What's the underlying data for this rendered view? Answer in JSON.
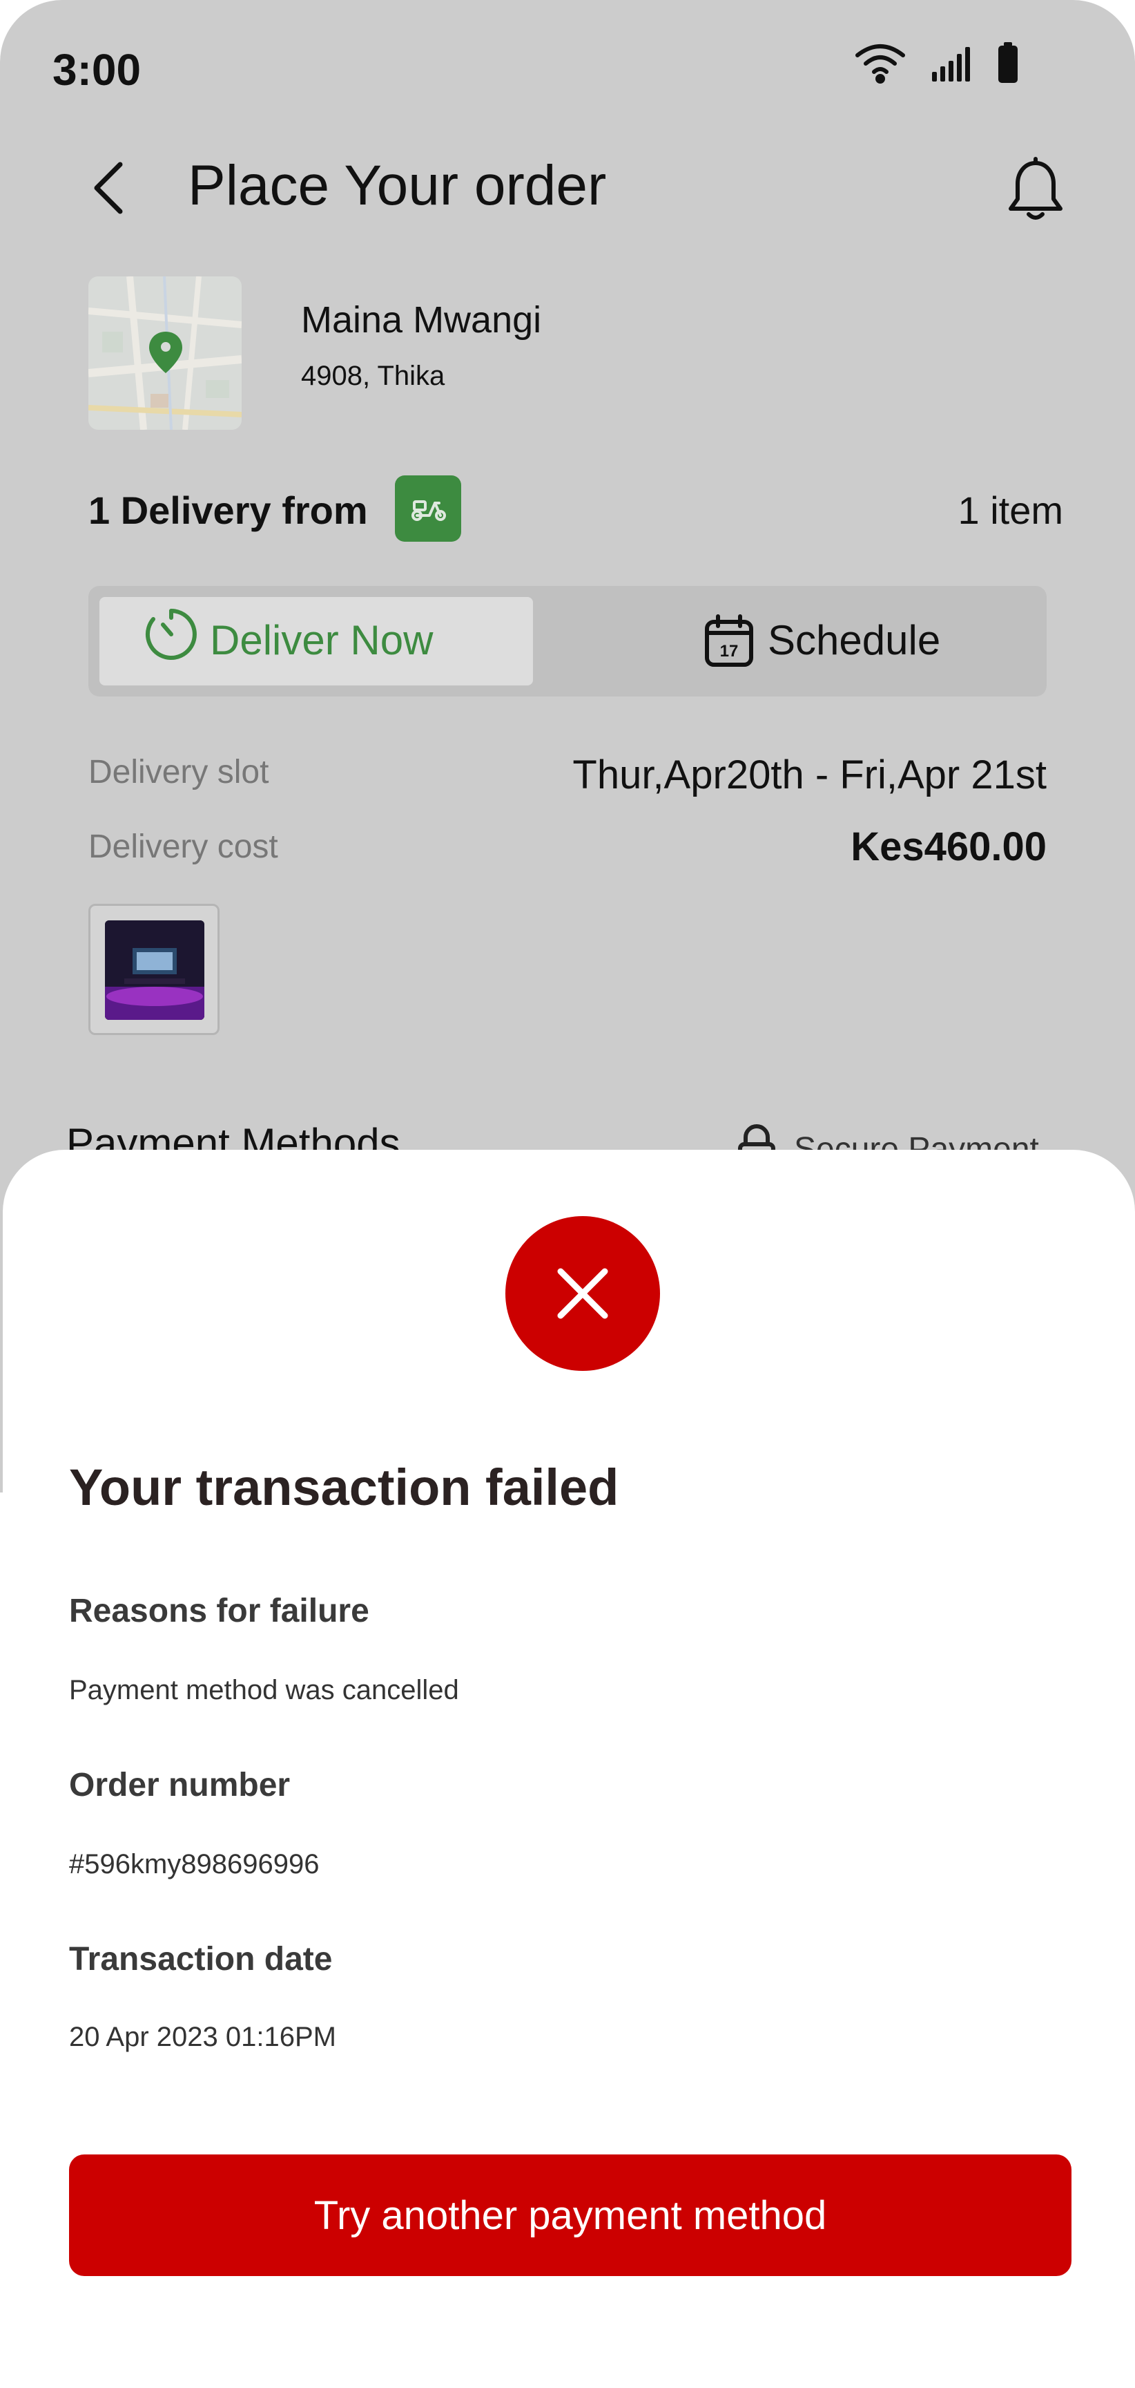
{
  "status_bar": {
    "time": "3:00",
    "icons": [
      "wifi-icon",
      "signal-icon",
      "battery-icon"
    ]
  },
  "header": {
    "title": "Place Your order",
    "back_icon": "chevron-left-icon",
    "notification_icon": "bell-icon"
  },
  "address": {
    "name": "Maina Mwangi",
    "line": "4908, Thika"
  },
  "delivery": {
    "from_label": "1 Delivery from",
    "item_count": "1 item"
  },
  "delivery_mode": {
    "options": [
      {
        "label": "Deliver Now",
        "icon": "timer-icon",
        "selected": true
      },
      {
        "label": "Schedule",
        "icon": "calendar-icon",
        "selected": false
      }
    ]
  },
  "slot": {
    "label": "Delivery slot",
    "value": "Thur,Apr20th - Fri,Apr 21st"
  },
  "cost": {
    "label": "Delivery cost",
    "value": "Kes460.00"
  },
  "payment": {
    "title": "Payment Methods",
    "secure_label": "Secure Payment"
  },
  "failure_sheet": {
    "title": "Your transaction failed",
    "reason_label": "Reasons for failure",
    "reason_value": "Payment method was cancelled",
    "order_label": "Order number",
    "order_value": "#596kmy898696996",
    "date_label": "Transaction date",
    "date_value": "20 Apr 2023 01:16PM",
    "cta_label": "Try another payment method"
  },
  "colors": {
    "accent_green": "#3d8b40",
    "error_red": "#cc0000",
    "overlay_gray": "#cccccc"
  }
}
